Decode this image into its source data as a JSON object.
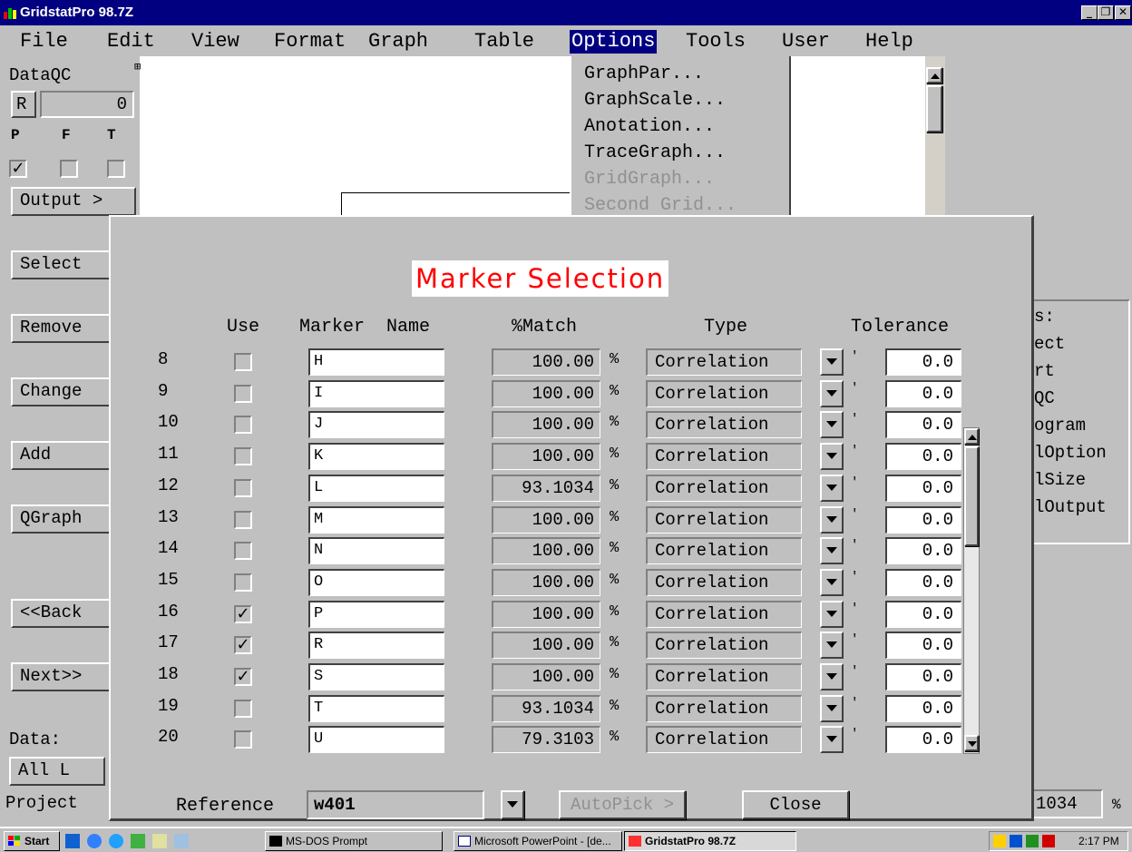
{
  "window": {
    "title": "GridstatPro 98.7Z"
  },
  "menu": [
    "File",
    "Edit",
    "View",
    "Format",
    "Graph",
    "Table",
    "Options",
    "Tools",
    "User",
    "Help"
  ],
  "options_menu": [
    {
      "label": "GraphPar...",
      "enabled": true
    },
    {
      "label": "GraphScale...",
      "enabled": true
    },
    {
      "label": "Anotation...",
      "enabled": true
    },
    {
      "label": "TraceGraph...",
      "enabled": true
    },
    {
      "label": "GridGraph...",
      "enabled": false
    },
    {
      "label": "Second Grid...",
      "enabled": false
    }
  ],
  "left_panel": {
    "header": "DataQC",
    "r_button": "R",
    "r_value": "0",
    "pft_labels": [
      "P",
      "F",
      "T"
    ],
    "pft_checked": [
      true,
      false,
      false
    ],
    "buttons": [
      "Output >",
      "Select",
      "Remove",
      "Change",
      "Add",
      "QGraph",
      "<<Back",
      "Next>>"
    ],
    "data_label": "Data:",
    "data_value": "All L",
    "project_label": "Project"
  },
  "right_panel": {
    "header_fragment": "s:",
    "items": [
      "ect",
      "rt",
      "QC",
      "ogram",
      "lOption",
      "lSize",
      "lOutput"
    ],
    "bottom_value": "1034",
    "bottom_unit": "%"
  },
  "dialog": {
    "title": "Marker Selection",
    "headers": {
      "use": "Use",
      "marker_name": "Marker  Name",
      "match": "%Match",
      "type": "Type",
      "tolerance": "Tolerance"
    },
    "pct_symbol": "%",
    "tick_symbol": "'",
    "rows": [
      {
        "num": "8",
        "use": false,
        "name": "H",
        "match": "100.00",
        "type": "Correlation",
        "tol": "0.0"
      },
      {
        "num": "9",
        "use": false,
        "name": "I",
        "match": "100.00",
        "type": "Correlation",
        "tol": "0.0"
      },
      {
        "num": "10",
        "use": false,
        "name": "J",
        "match": "100.00",
        "type": "Correlation",
        "tol": "0.0"
      },
      {
        "num": "11",
        "use": false,
        "name": "K",
        "match": "100.00",
        "type": "Correlation",
        "tol": "0.0"
      },
      {
        "num": "12",
        "use": false,
        "name": "L",
        "match": "93.1034",
        "type": "Correlation",
        "tol": "0.0"
      },
      {
        "num": "13",
        "use": false,
        "name": "M",
        "match": "100.00",
        "type": "Correlation",
        "tol": "0.0"
      },
      {
        "num": "14",
        "use": false,
        "name": "N",
        "match": "100.00",
        "type": "Correlation",
        "tol": "0.0"
      },
      {
        "num": "15",
        "use": false,
        "name": "O",
        "match": "100.00",
        "type": "Correlation",
        "tol": "0.0"
      },
      {
        "num": "16",
        "use": true,
        "name": "P",
        "match": "100.00",
        "type": "Correlation",
        "tol": "0.0"
      },
      {
        "num": "17",
        "use": true,
        "name": "R",
        "match": "100.00",
        "type": "Correlation",
        "tol": "0.0"
      },
      {
        "num": "18",
        "use": true,
        "name": "S",
        "match": "100.00",
        "type": "Correlation",
        "tol": "0.0"
      },
      {
        "num": "19",
        "use": false,
        "name": "T",
        "match": "93.1034",
        "type": "Correlation",
        "tol": "0.0"
      },
      {
        "num": "20",
        "use": false,
        "name": "U",
        "match": "79.3103",
        "type": "Correlation",
        "tol": "0.0"
      }
    ],
    "reference_label": "Reference",
    "reference_value": "w401",
    "autopick_label": "AutoPick >",
    "close_label": "Close"
  },
  "taskbar": {
    "start": "Start",
    "tasks": [
      "MS-DOS Prompt",
      "Microsoft PowerPoint - [de...",
      "GridstatPro 98.7Z"
    ],
    "clock": "2:17 PM"
  }
}
